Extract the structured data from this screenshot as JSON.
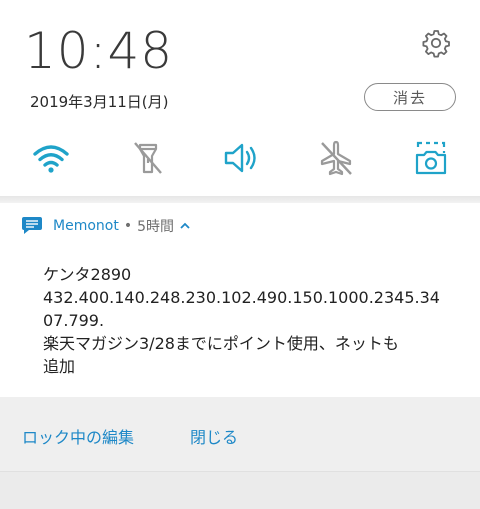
{
  "quick_settings": {
    "time": "10:48",
    "date": "2019年3月11日(月)",
    "clear_label": "消去",
    "tiles": [
      {
        "name": "wifi",
        "icon": "wifi-icon",
        "active": true
      },
      {
        "name": "flashlight",
        "icon": "flashlight-off-icon",
        "active": false
      },
      {
        "name": "sound",
        "icon": "volume-icon",
        "active": true
      },
      {
        "name": "airplane-mode",
        "icon": "airplane-off-icon",
        "active": false
      },
      {
        "name": "screenshot",
        "icon": "screenshot-icon",
        "active": true
      }
    ],
    "colors": {
      "active": "#1fa3c9",
      "inactive": "#9a9a9a"
    }
  },
  "notification": {
    "app_name": "Memonot",
    "separator": "•",
    "time_ago": "5時間",
    "body_lines": [
      "ケンタ2890",
      "432.400.140.248.230.102.490.150.1000.2345.34",
      "07.799.",
      "楽天マガジン3/28までにポイント使用、ネットも",
      "追加"
    ],
    "actions": [
      "ロック中の編集",
      "閉じる"
    ],
    "accent": "#1e88c7"
  }
}
